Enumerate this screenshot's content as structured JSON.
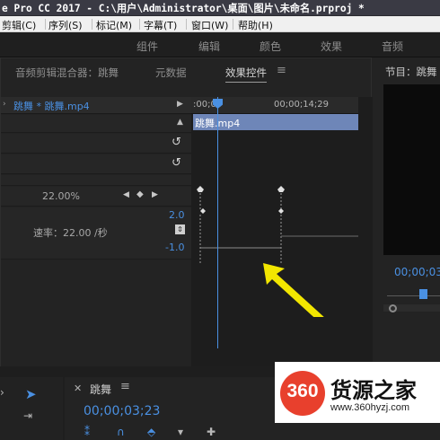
{
  "window": {
    "title": "e Pro CC 2017 - C:\\用户\\Administrator\\桌面\\图片\\未命名.prproj *"
  },
  "menu": {
    "items": [
      "剪辑(C)",
      "序列(S)",
      "标记(M)",
      "字幕(T)",
      "窗口(W)",
      "帮助(H)"
    ]
  },
  "workspaces": {
    "tabs": [
      "组件",
      "编辑",
      "颜色",
      "效果",
      "音频"
    ]
  },
  "left_panel": {
    "tabs": [
      "音频剪辑混合器：跳舞",
      "元数据",
      "效果控件"
    ],
    "active_tab": "效果控件",
    "clip_selector": "跳舞 * 跳舞.mp4",
    "ruler_start": ":00;00",
    "ruler_end": "00;00;14;29",
    "clip_name": "跳舞.mp4",
    "percent_value": "22.00%",
    "graph_max": "2.0",
    "graph_min": "-1.0",
    "speed_label": "速率：22.00 /秒"
  },
  "right_panel": {
    "tab": "节目：跳舞",
    "timecode": "00;00;03"
  },
  "sequence": {
    "tab": "跳舞",
    "timecode": "00;00;03;23"
  },
  "watermark": {
    "logo": "360",
    "title": "货源之家",
    "url": "www.360hyzj.com"
  },
  "colors": {
    "accent": "#4a90e2",
    "clip": "#6e86b8",
    "arrow": "#f2e600",
    "logo_red": "#e8402d"
  }
}
